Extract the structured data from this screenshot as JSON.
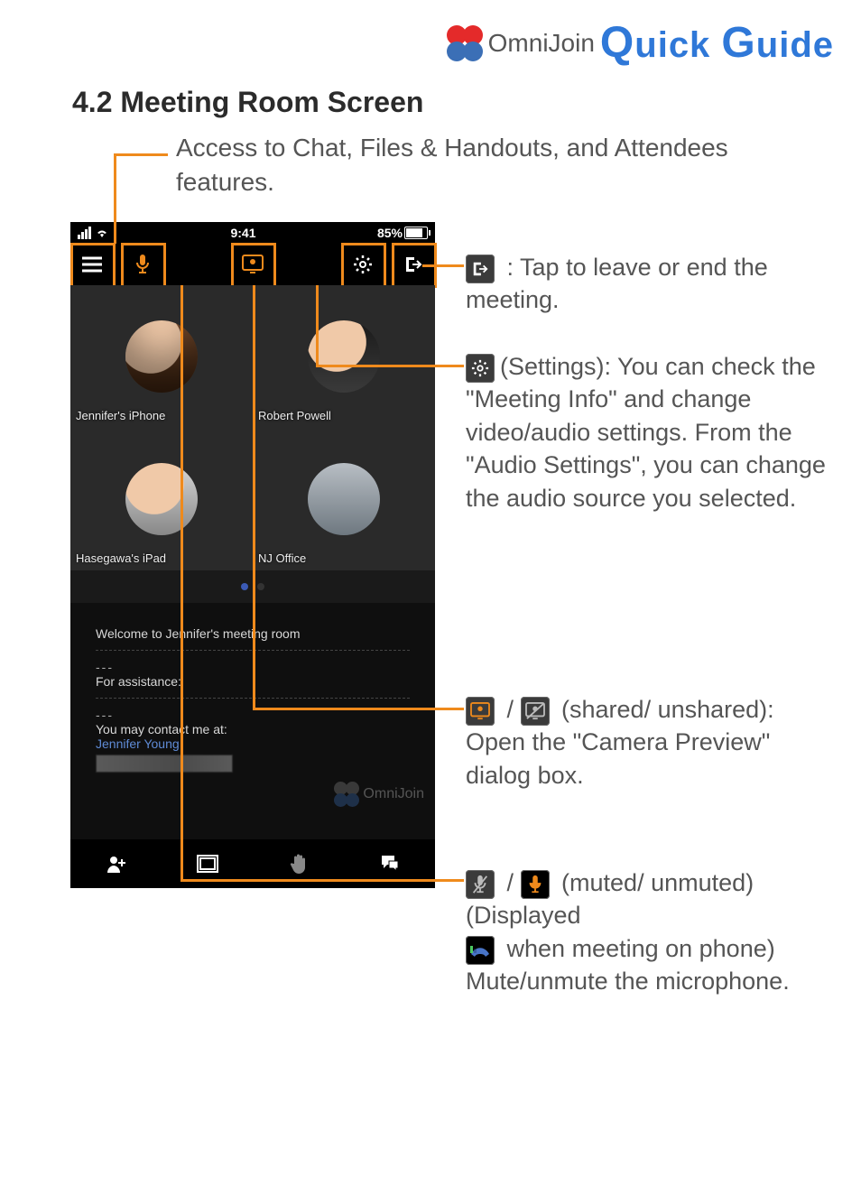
{
  "header": {
    "product": "OmniJoin",
    "guide_prefix": "Q",
    "guide_mid": "uick ",
    "guide_prefix2": "G",
    "guide_suffix": "uide"
  },
  "section_title": "4.2 Meeting Room Screen",
  "access_desc": "Access to Chat, Files & Handouts, and Attendees features.",
  "phone": {
    "status": {
      "time": "9:41",
      "battery": "85%"
    },
    "videos": [
      {
        "label": "Jennifer's iPhone"
      },
      {
        "label": "Robert Powell"
      },
      {
        "label": "Hasegawa's iPad"
      },
      {
        "label": "NJ Office"
      }
    ],
    "chat": {
      "line1": "Welcome to Jennifer's meeting room",
      "line2": "For assistance:",
      "line3a": "You may contact me at:",
      "line3b": "Jennifer Young"
    },
    "watermark": "OmniJoin"
  },
  "annotations": {
    "leave": ": Tap to leave or end the meeting.",
    "settings": "(Settings): You can check the \"Meeting Info\" and change video/audio settings. From the \"Audio Settings\", you can change the audio source you selected.",
    "camera_pre": "(shared/ unshared):",
    "camera_body": "Open the \"Camera Preview\" dialog box.",
    "mic_pre": "(muted/ unmuted) (Displayed",
    "mic_mid": "when meeting on phone)",
    "mic_body": "Mute/unmute the microphone."
  },
  "slash": " / "
}
